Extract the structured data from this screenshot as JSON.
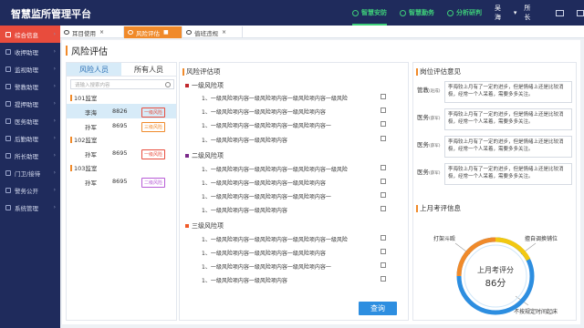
{
  "app": {
    "title": "智慧监所管理平台"
  },
  "topnav": [
    {
      "label": "智慧安防",
      "active": true
    },
    {
      "label": "智慧勤务",
      "active": false
    },
    {
      "label": "分析研判",
      "active": false
    }
  ],
  "user": {
    "name": "吴海",
    "role": "所长"
  },
  "sidebar": [
    {
      "label": "综合信息",
      "active": true
    },
    {
      "label": "收押助理"
    },
    {
      "label": "监视助理"
    },
    {
      "label": "警教助理"
    },
    {
      "label": "提押助理"
    },
    {
      "label": "医务助理"
    },
    {
      "label": "后勤助理"
    },
    {
      "label": "所长助理"
    },
    {
      "label": "门卫/接待"
    },
    {
      "label": "警务公开"
    },
    {
      "label": "系统管理"
    }
  ],
  "tabs": [
    {
      "label": "耳目使用",
      "active": false
    },
    {
      "label": "风险评估",
      "active": true
    },
    {
      "label": "值班违规",
      "active": false
    }
  ],
  "page_title": "风险评估",
  "left": {
    "tabs": [
      "风险人员",
      "所有人员"
    ],
    "search_placeholder": "请输入搜索内容",
    "rooms": [
      {
        "name": "101监室",
        "people": [
          {
            "name": "李海",
            "no": "8826",
            "badge": "一级风险",
            "badge_color": "#e84c3d"
          },
          {
            "name": "孙军",
            "no": "8695",
            "badge": "三级风险",
            "badge_color": "#f08a2a"
          }
        ]
      },
      {
        "name": "102监室",
        "people": [
          {
            "name": "孙军",
            "no": "8695",
            "badge": "一级风险",
            "badge_color": "#e84c3d"
          }
        ]
      },
      {
        "name": "103监室",
        "people": [
          {
            "name": "孙军",
            "no": "8695",
            "badge": "二级风险",
            "badge_color": "#b75bd6"
          }
        ]
      }
    ]
  },
  "mid": {
    "title": "风险评估项",
    "levels": [
      {
        "label": "一级风险项",
        "color": "#c0282d",
        "items": [
          "1、一级风险项内容一级风险项内容一级风险项内容一级风险",
          "1、一级风险项内容一级风险项内容一级风险项内容",
          "1、一级风险项内容一级风险项内容一级风险项内容一",
          "1、一级风险项内容一级风险项内容"
        ]
      },
      {
        "label": "二级风险项",
        "color": "#7a2a8a",
        "items": [
          "1、一级风险项内容一级风险项内容一级风险项内容一级风险",
          "1、一级风险项内容一级风险项内容一级风险项内容",
          "1、一级风险项内容一级风险项内容一级风险项内容一",
          "1、一级风险项内容一级风险项内容"
        ]
      },
      {
        "label": "三级风险项",
        "color": "#f05a28",
        "items": [
          "1、一级风险项内容一级风险项内容一级风险项内容一级风险",
          "1、一级风险项内容一级风险项内容一级风险项内容",
          "1、一级风险项内容一级风险项内容一级风险项内容一",
          "1、一级风险项内容一级风险项内容"
        ]
      }
    ],
    "query_label": "查询"
  },
  "right": {
    "title": "岗位评估意见",
    "opinions": [
      {
        "role": "管教",
        "sub": "(赵成)",
        "text": "李海较上月有了一定的进步，但是情绪上还是比较消极，经常一个人呆着，需要多多关注。"
      },
      {
        "role": "医务",
        "sub": "(薛军)",
        "text": "李海较上月有了一定的进步，但是情绪上还是比较消极，经常一个人呆着，需要多多关注。"
      },
      {
        "role": "医务",
        "sub": "(薛军)",
        "text": "李海较上月有了一定的进步，但是情绪上还是比较消极，经常一个人呆着，需要多多关注。"
      },
      {
        "role": "医务",
        "sub": "(薛军)",
        "text": "李海较上月有了一定的进步，但是情绪上还是比较消极，经常一个人呆着，需要多多关注。"
      }
    ],
    "month_title": "上月考评信息",
    "score_label": "上月考评分",
    "score": "86分",
    "score_value": 86,
    "tags": [
      "打架斗殴",
      "擅自调换铺位",
      "不按规定时间起床"
    ]
  },
  "colors": {
    "accent": "#f08a2a",
    "nav_bg": "#1f2b5c",
    "primary": "#2d8ee0"
  }
}
